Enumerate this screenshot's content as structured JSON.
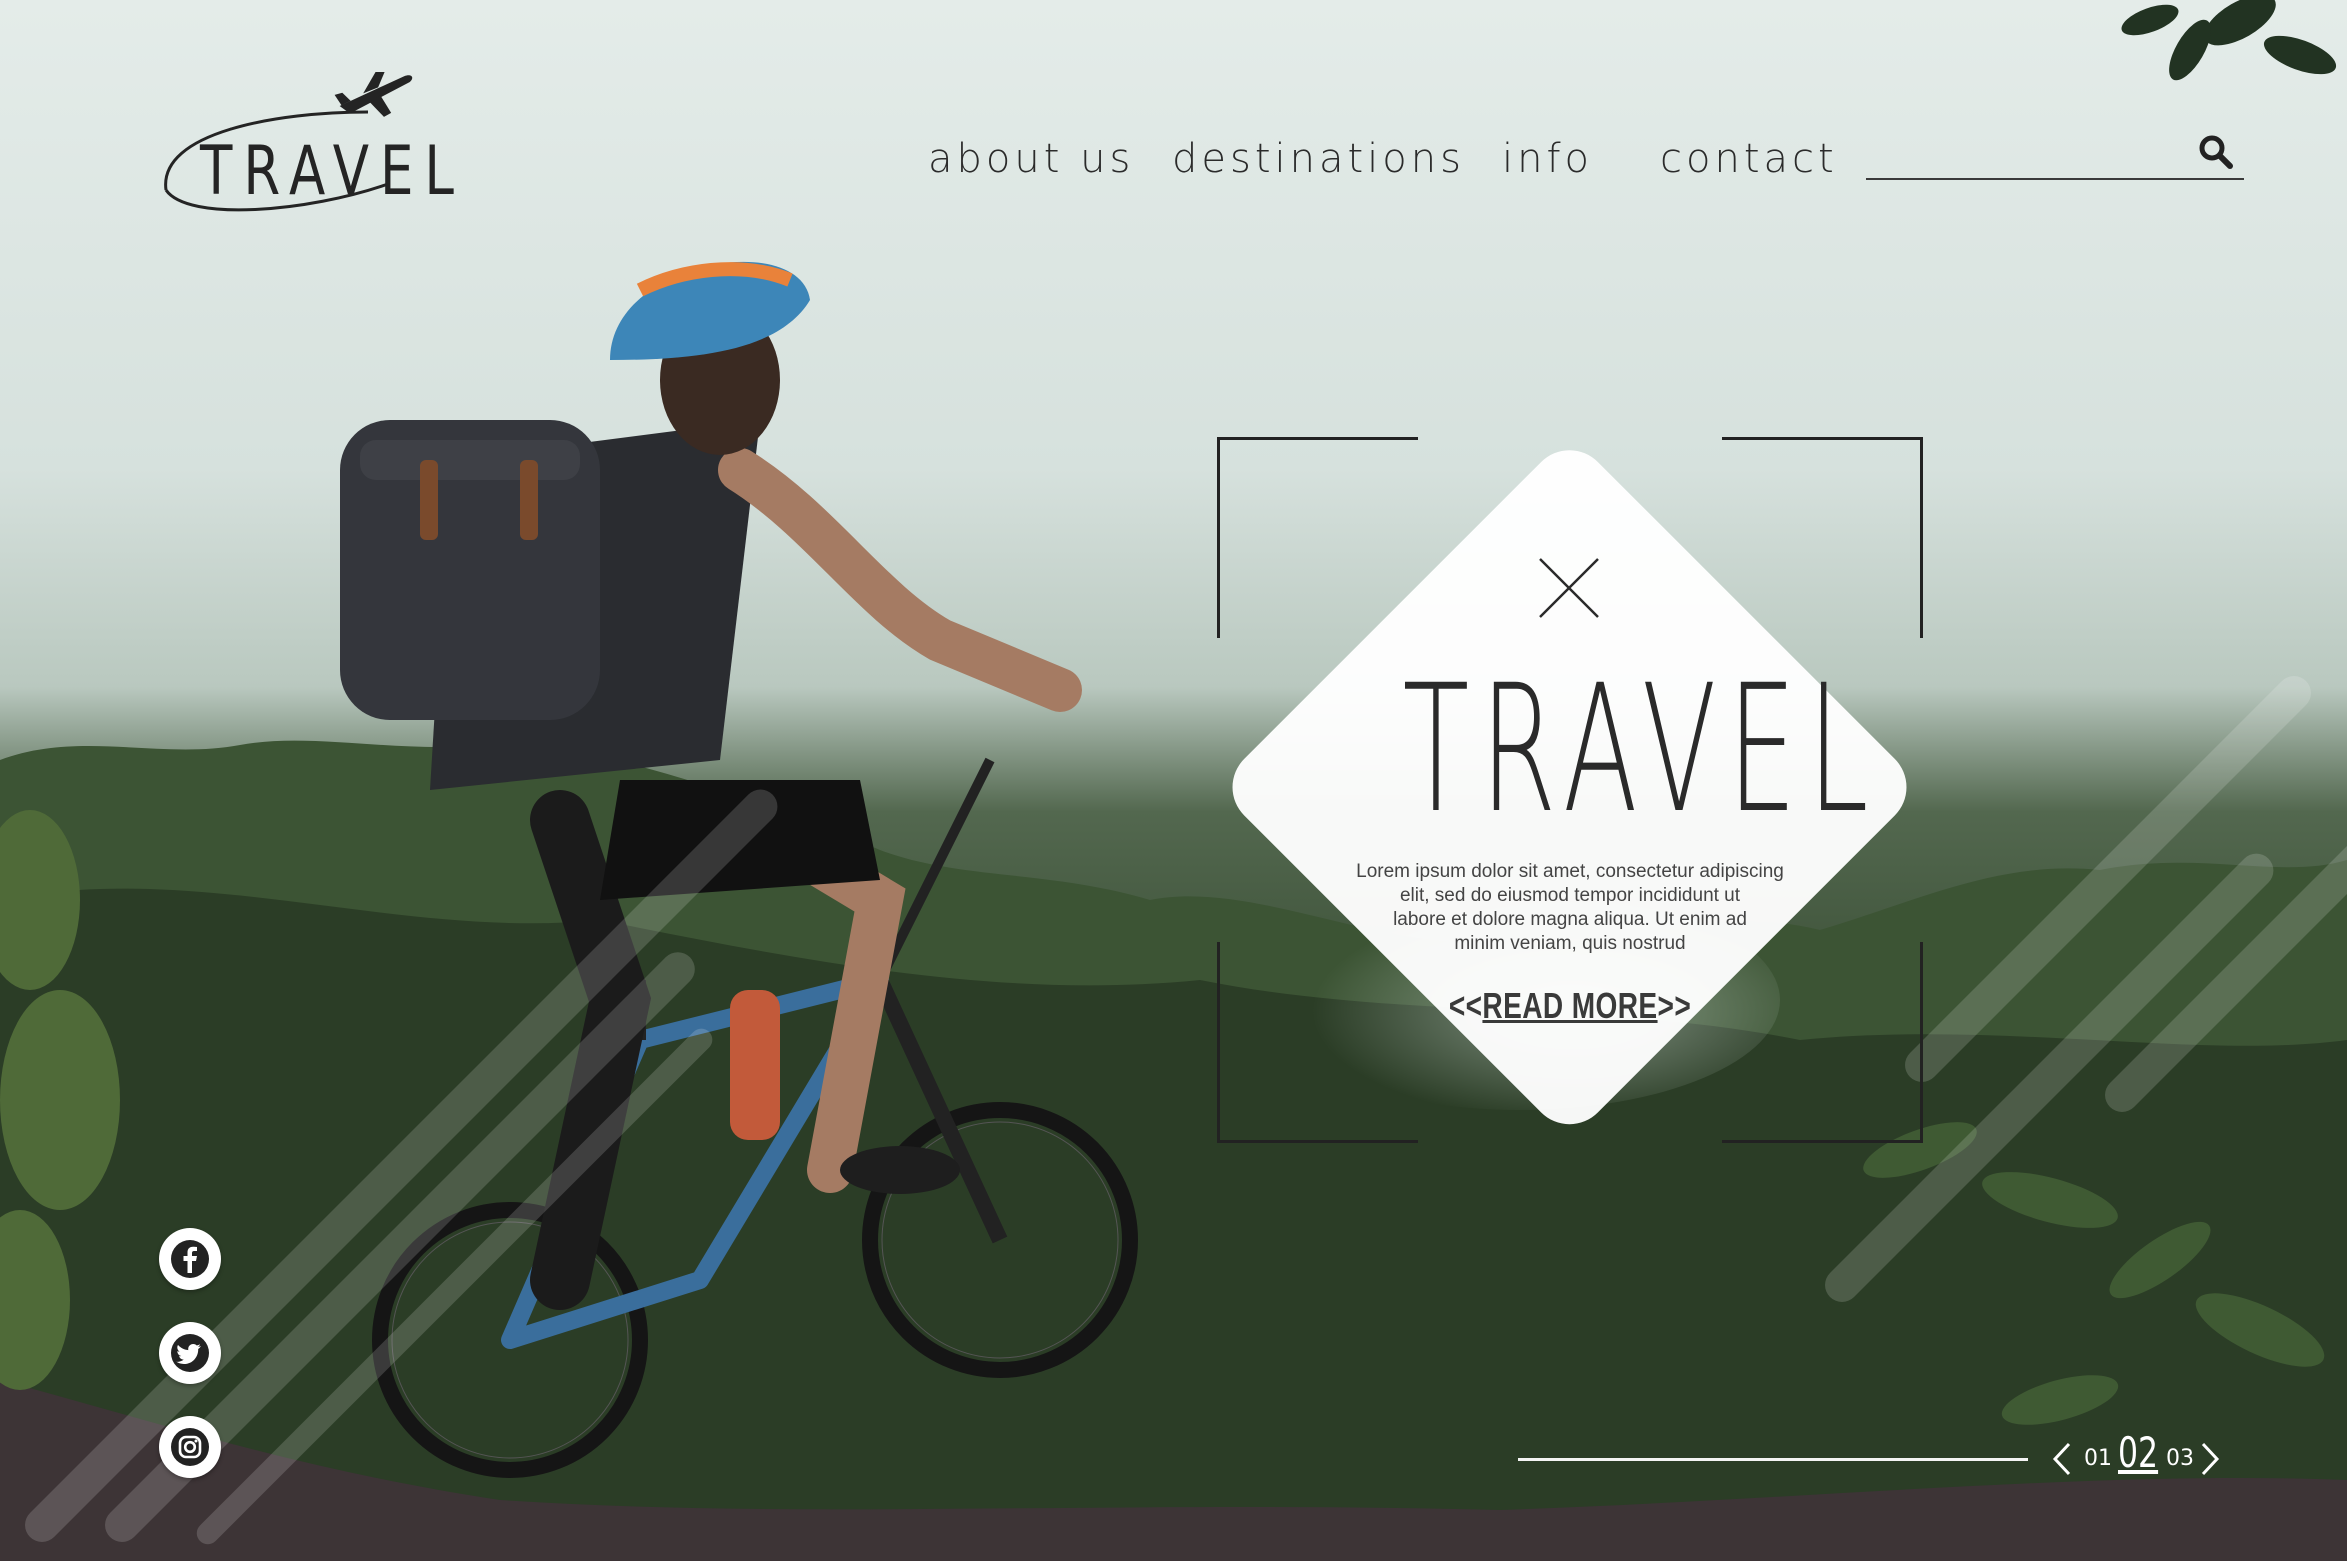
{
  "brand": {
    "logo_text": "TRAVEL",
    "logo_icon": "airplane-icon"
  },
  "nav": {
    "items": [
      {
        "label": "about us"
      },
      {
        "label": "destinations"
      },
      {
        "label": "info"
      },
      {
        "label": "contact"
      }
    ]
  },
  "search": {
    "placeholder": "",
    "icon": "search-icon"
  },
  "hero": {
    "icon": "close-icon",
    "title": "TRAVEL",
    "body_lines": [
      "Lorem ipsum dolor sit amet, consectetur adipiscing",
      "elit, sed do eiusmod tempor incididunt ut",
      "labore et dolore magna aliqua. Ut enim ad",
      "minim veniam, quis nostrud"
    ],
    "read_more_prefix": "<<",
    "read_more_label": "READ MORE",
    "read_more_suffix": ">>"
  },
  "social": [
    {
      "icon": "facebook-icon"
    },
    {
      "icon": "twitter-icon"
    },
    {
      "icon": "instagram-icon"
    }
  ],
  "pagination": {
    "prev": "01",
    "current": "02",
    "next": "03",
    "prev_icon": "chevron-left-icon",
    "next_icon": "chevron-right-icon"
  },
  "colors": {
    "text_dark": "#2a2a2a",
    "card_white": "#ffffff",
    "foliage": "#2e4229"
  }
}
